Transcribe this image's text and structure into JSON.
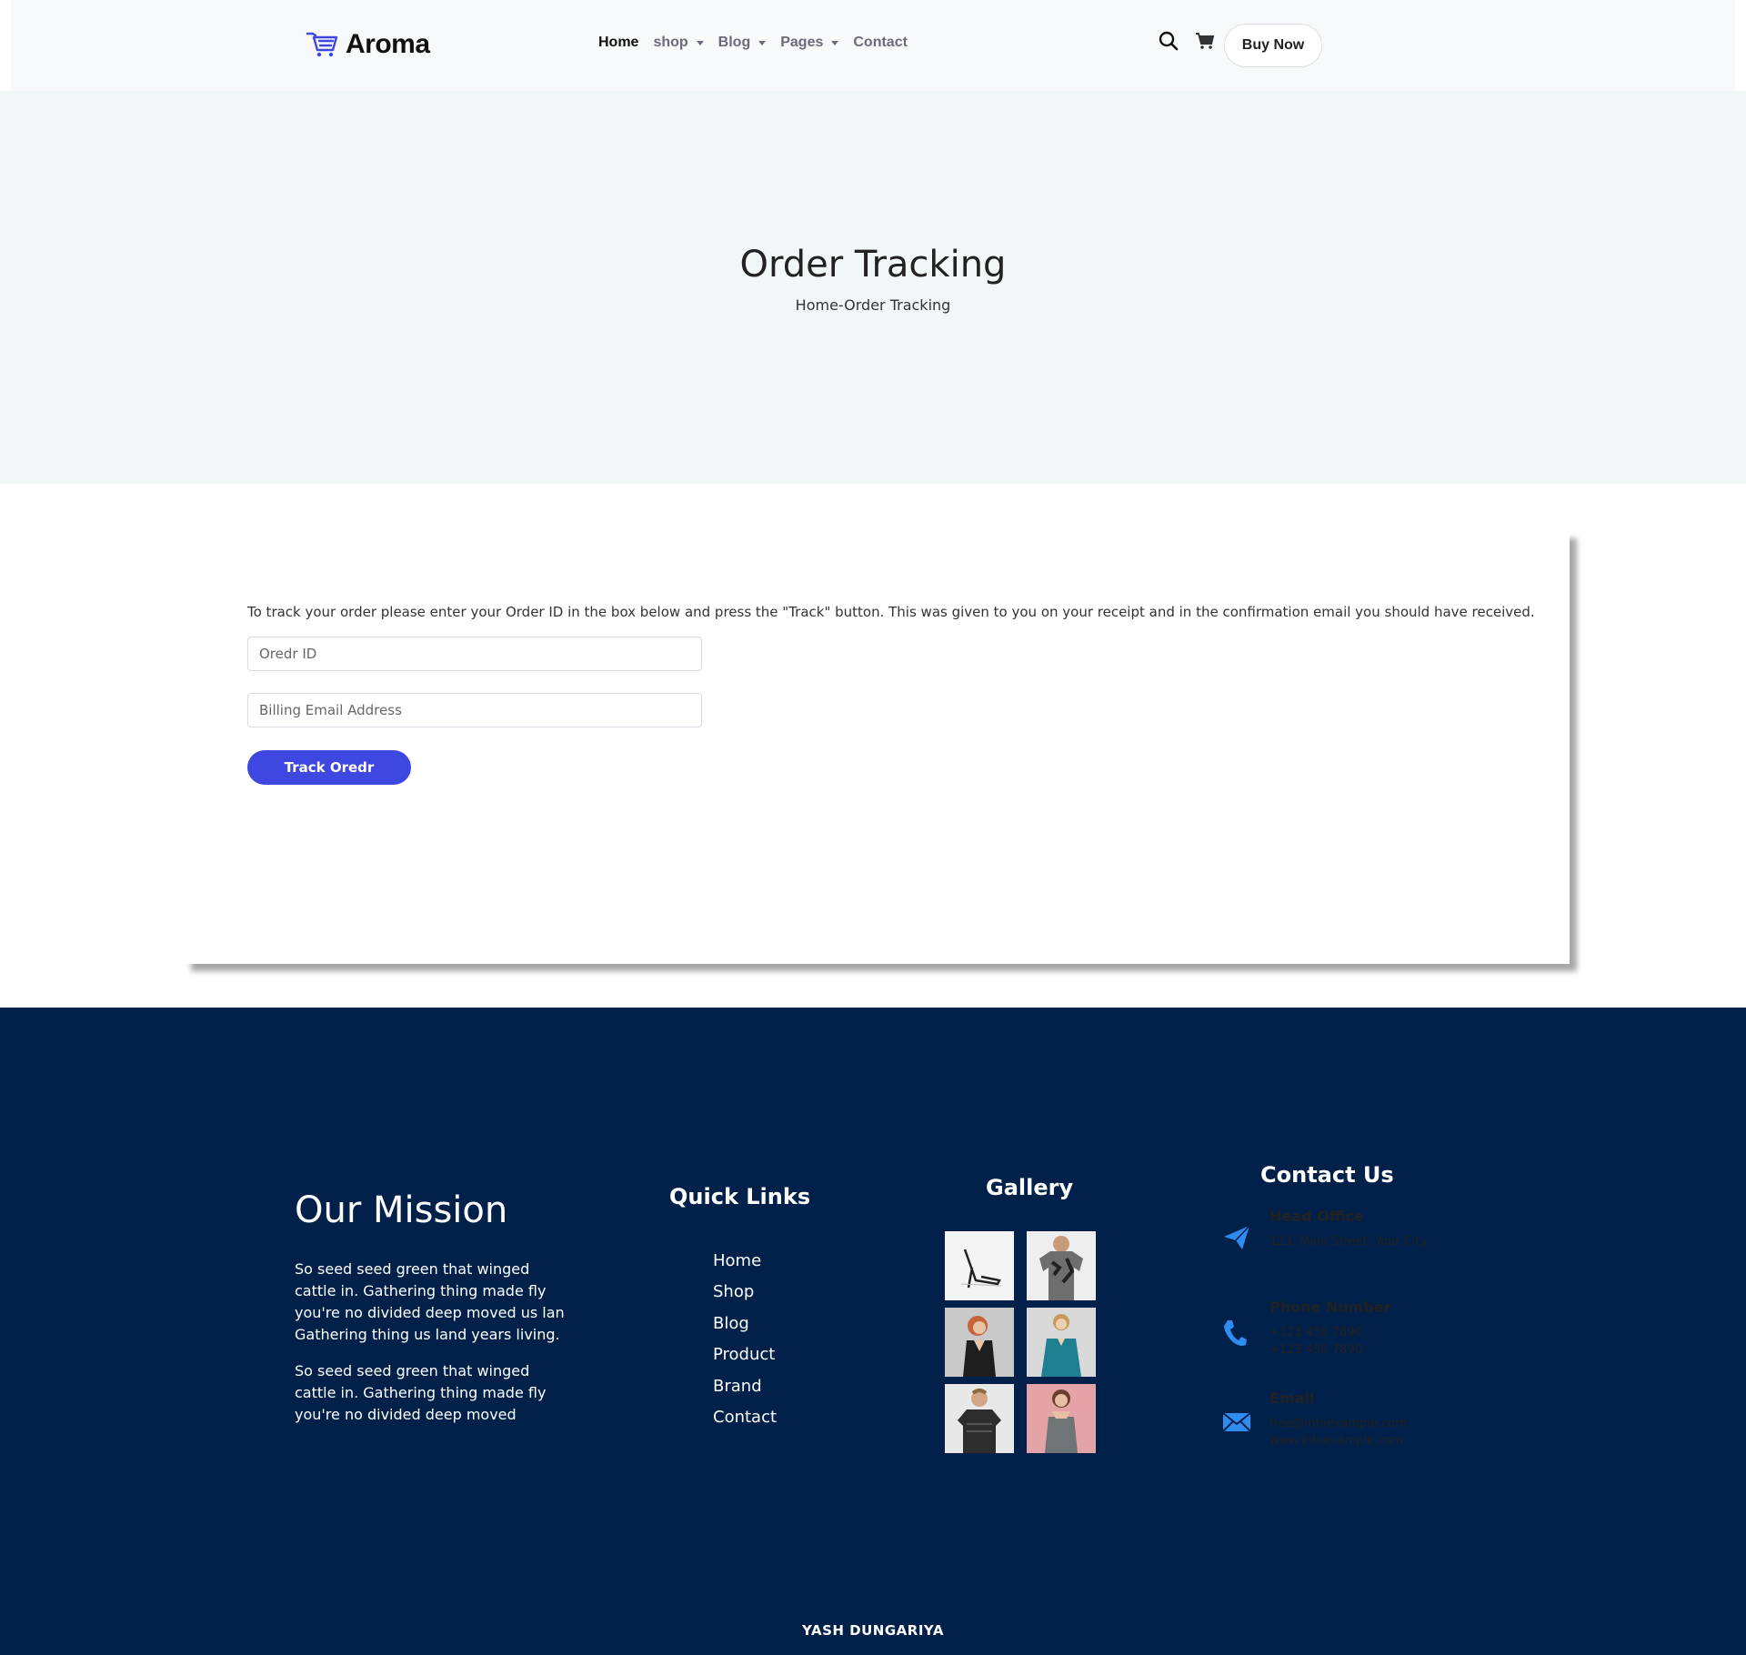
{
  "brand": {
    "name": "Aroma",
    "accent": "#3e47e0"
  },
  "nav": {
    "items": [
      {
        "label": "Home",
        "active": true,
        "dropdown": false
      },
      {
        "label": "shop",
        "active": false,
        "dropdown": true
      },
      {
        "label": "Blog",
        "active": false,
        "dropdown": true
      },
      {
        "label": "Pages",
        "active": false,
        "dropdown": true
      },
      {
        "label": "Contact",
        "active": false,
        "dropdown": false
      }
    ],
    "icons": [
      "search-icon",
      "cart-icon"
    ],
    "cta_label": "Buy Now"
  },
  "hero": {
    "title": "Order Tracking",
    "breadcrumb": "Home-Order Tracking"
  },
  "tracking": {
    "instructions": "To track your order please enter your Order ID in the box below and press the \"Track\" button. This was given to you on your receipt and in the confirmation email you should have received.",
    "order_id_placeholder": "Oredr ID",
    "email_placeholder": "Billing Email Address",
    "button_label": "Track Oredr"
  },
  "footer": {
    "background": "#01214a",
    "mission": {
      "title": "Our Mission",
      "paragraphs": [
        "So seed seed green that winged cattle in. Gathering thing made fly you're no divided deep moved us lan Gathering thing us land years living.",
        "So seed seed green that winged cattle in. Gathering thing made fly you're no divided deep moved"
      ]
    },
    "quick_links": {
      "title": "Quick Links",
      "items": [
        "Home",
        "Shop",
        "Blog",
        "Product",
        "Brand",
        "Contact"
      ]
    },
    "gallery": {
      "title": "Gallery",
      "images": [
        "heel-sandal",
        "camo-tshirt",
        "woman-black-dress",
        "woman-teal-dress",
        "man-jersey",
        "woman-grey-top"
      ]
    },
    "contact": {
      "title": "Contact Us",
      "head_office": {
        "label": "Head Office",
        "values": [
          "123, Main Street, Your City"
        ],
        "icon": "paper-plane-icon"
      },
      "phone": {
        "label": "Phone Number",
        "values": [
          "+123 456 7890",
          "+123 456 7890"
        ],
        "icon": "phone-icon"
      },
      "email": {
        "label": "Email",
        "values": [
          "free@infoexample.com",
          "www.infoexample.com"
        ],
        "icon": "envelope-icon"
      },
      "icon_color": "#2f8cf0"
    },
    "credit": "YASH DUNGARIYA"
  }
}
